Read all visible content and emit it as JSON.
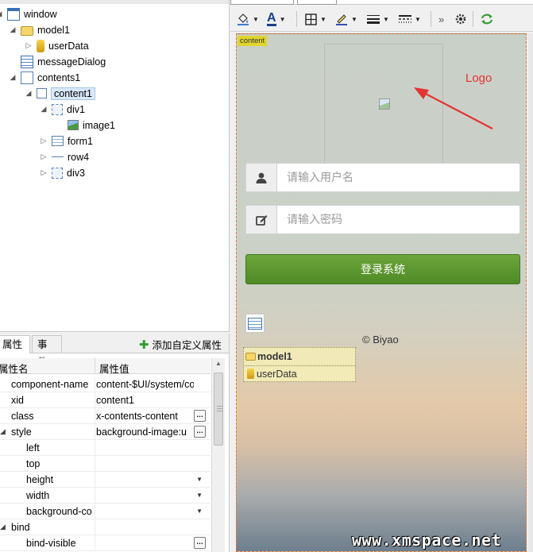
{
  "outline": {
    "items": [
      {
        "label": "window"
      },
      {
        "label": "model1"
      },
      {
        "label": "userData"
      },
      {
        "label": "messageDialog"
      },
      {
        "label": "contents1"
      },
      {
        "label": "content1"
      },
      {
        "label": "div1"
      },
      {
        "label": "image1"
      },
      {
        "label": "form1"
      },
      {
        "label": "row4"
      },
      {
        "label": "div3"
      }
    ]
  },
  "properties": {
    "tabs": [
      {
        "label": "属性"
      },
      {
        "label": "事件"
      }
    ],
    "add_custom_label": "添加自定义属性",
    "header": {
      "name": "属性名",
      "value": "属性值"
    },
    "rows": [
      {
        "name": "component-name",
        "value": "content-$UI/system/con"
      },
      {
        "name": "xid",
        "value": "content1"
      },
      {
        "name": "class",
        "value": "x-contents-content"
      },
      {
        "name": "style",
        "value": "background-image:u"
      },
      {
        "name": "left",
        "value": ""
      },
      {
        "name": "top",
        "value": ""
      },
      {
        "name": "height",
        "value": ""
      },
      {
        "name": "width",
        "value": ""
      },
      {
        "name": "background-co",
        "value": ""
      },
      {
        "name": "bind",
        "value": ""
      },
      {
        "name": "bind-visible",
        "value": ""
      }
    ],
    "ellipsis_label": "…",
    "dropdown_arrow": "▼"
  },
  "toolbar": {
    "font_color_glyph": "A",
    "more_glyph": "»"
  },
  "canvas": {
    "content_tag": "content",
    "logo_annotation": "Logo",
    "username_placeholder": "请输入用户名",
    "password_placeholder": "请输入密码",
    "login_button": "登录系统",
    "copyright": "© Biyao",
    "model_box": {
      "title": "model1",
      "item": "userData"
    }
  },
  "watermark": "www.xmspace.net",
  "colors": {
    "login_button": "#5a962e",
    "annotation_red": "#e53333",
    "content_tag": "#e0d42e",
    "canvas_border": "#ee7a2a"
  },
  "icons": {
    "username": "user-icon",
    "password": "edit-icon",
    "refresh": "refresh-icon",
    "gear": "gear-icon"
  }
}
